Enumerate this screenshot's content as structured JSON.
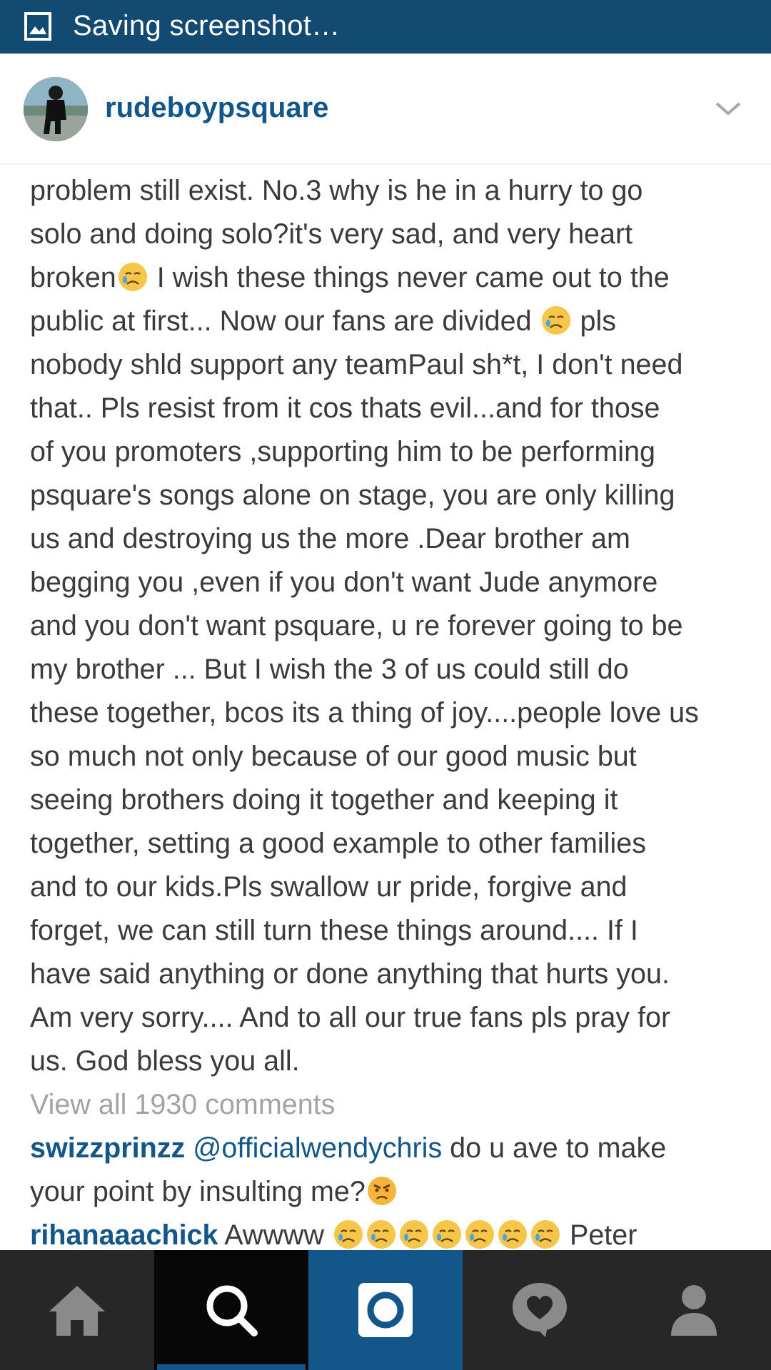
{
  "status_bar": {
    "notification_text": "Saving screenshot…",
    "icon": "image-icon",
    "background": "#134a72"
  },
  "post": {
    "username": "rudeboypsquare",
    "menu_icon": "chevron-down-icon"
  },
  "caption": {
    "lines": [
      "problem still exist. No.3 why is he in a hurry to go",
      "solo and doing solo?it's very sad, and very heart",
      "broken",
      " I wish these things never came out to the",
      "public at first... Now our fans are divided ",
      " pls",
      "nobody shld support any teamPaul sh*t, I don't need",
      "that.. Pls resist from it cos thats evil...and for those",
      "of you promoters ,supporting him to be performing",
      "psquare's songs alone on stage, you are only killing",
      "us and destroying us the more .Dear brother am",
      "begging you ,even if you don't want Jude anymore",
      "and you don't want psquare, u re forever going to be",
      "my brother ... But I wish the 3 of us could still do",
      "these together, bcos its a thing of joy....people love us",
      "so much not only because of our good music but",
      "seeing brothers doing it together and keeping it",
      "together, setting a good example to other families",
      "and to our kids.Pls swallow ur pride, forgive and",
      "forget, we can still turn these things around.... If I",
      "have said anything or done anything that hurts you.",
      "Am very sorry.... And to all our true fans pls pray for",
      "us. God bless you all."
    ]
  },
  "comments": {
    "view_all": "View all 1930 comments",
    "items": [
      {
        "user": "swizzprinzz",
        "mention": "@officialwendychris",
        "text_line1": " do u ave to make",
        "text_line2": "your point by insulting me?"
      },
      {
        "user": "rihanaaachick",
        "text_before": " Awwww ",
        "text_after": " Peter"
      }
    ]
  },
  "bottom_nav": {
    "items": [
      "home-icon",
      "search-icon",
      "camera-icon",
      "activity-heart-icon",
      "profile-icon"
    ],
    "active": "search-icon",
    "accent": "#12568a"
  }
}
